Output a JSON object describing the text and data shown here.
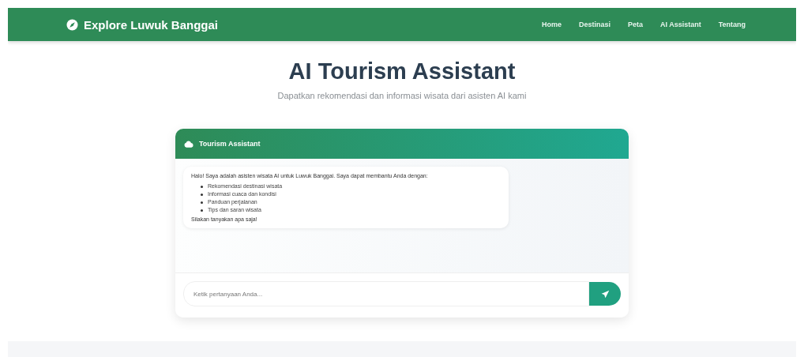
{
  "navbar": {
    "brand": "Explore Luwuk Banggai",
    "links": [
      {
        "label": "Home",
        "selected": false
      },
      {
        "label": "Destinasi",
        "selected": false
      },
      {
        "label": "Peta",
        "selected": false
      },
      {
        "label": "AI Assistant",
        "selected": false
      },
      {
        "label": "Tentang",
        "selected": false
      }
    ]
  },
  "header": {
    "title": "AI Tourism Assistant",
    "subtitle": "Dapatkan rekomendasi dan informasi wisata dari asisten AI kami"
  },
  "chat": {
    "title": "Tourism Assistant",
    "messages": [
      {
        "intro": "Halo! Saya adalah asisten wisata AI untuk Luwuk Banggai. Saya dapat membantu Anda dengan:",
        "items": [
          "Rekomendasi destinasi wisata",
          "Informasi cuaca dan kondisi",
          "Panduan perjalanan",
          "Tips dan saran wisata"
        ],
        "outro": "Silakan tanyakan apa saja!"
      }
    ],
    "input": {
      "placeholder": "Ketik pertanyaan Anda..."
    }
  }
}
